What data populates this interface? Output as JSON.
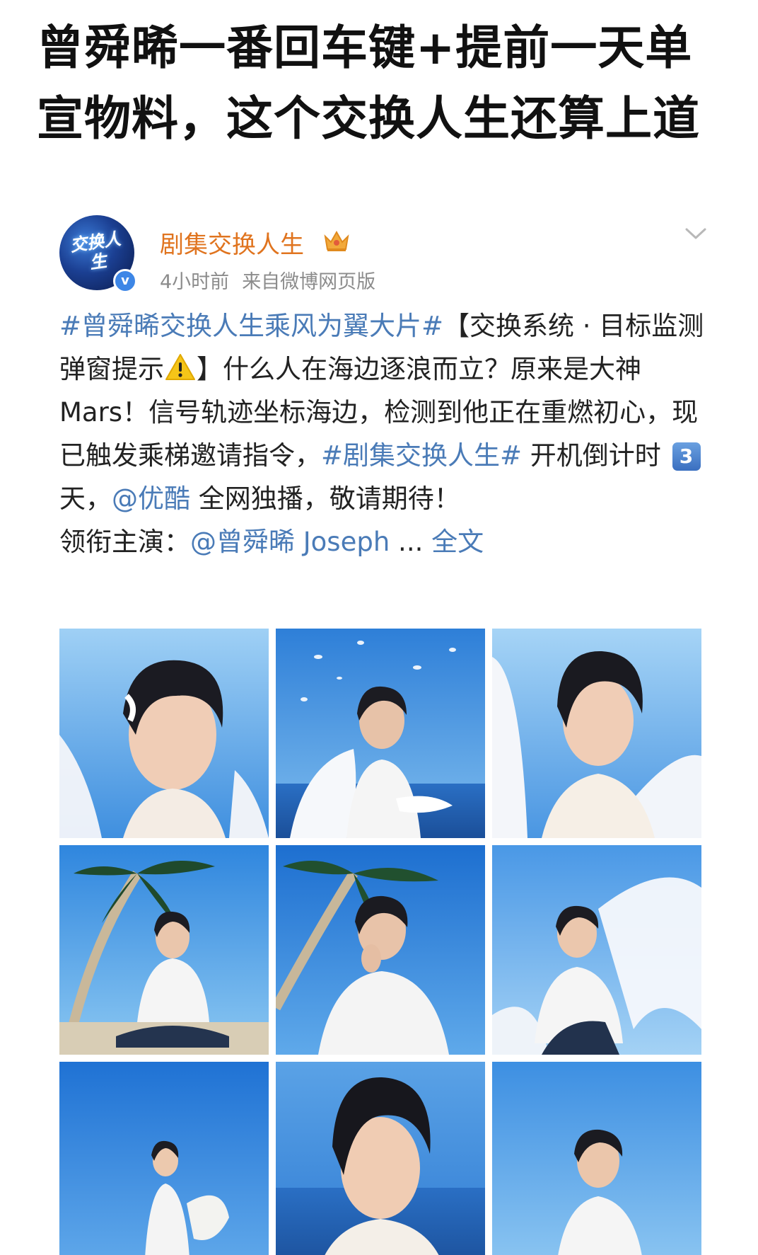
{
  "headline": {
    "line1": "曾舜晞一番回车键+提前一天单",
    "line2": "宣物料，这个交换人生还算上道"
  },
  "post": {
    "avatar_text": "交换人生",
    "verified_mark": "v",
    "account_name": "剧集交换人生",
    "time_ago": "4小时前",
    "source": "来自微博网页版",
    "text": {
      "tag1": "#曾舜晞交换人生乘风为翼大片#",
      "seg1": "【交换系统 · 目标监测弹窗提示",
      "seg2": "】什么人在海边逐浪而立？原来是大神Mars！信号轨迹坐标海边，检测到他正在重燃初心，现已触发乘梯邀请指令，",
      "tag2": "#剧集交换人生#",
      "seg3": " 开机倒计时 ",
      "countdown": "3",
      "seg4": "天，",
      "mention1": "@优酷",
      "seg5": " 全网独播，敬请期待！",
      "seg6": "领衔主演：",
      "mention2": "@曾舜晞 Joseph",
      "ellipsis": " ... ",
      "full_text_link": "全文"
    }
  },
  "colors": {
    "link": "#4a7bb7",
    "account_name": "#e0741f",
    "meta": "#8c8c8c",
    "sky_light": "#8fc4f0",
    "sky_deep": "#1e6fd0"
  },
  "photos": [
    {
      "scene": "portrait-wing"
    },
    {
      "scene": "doves-sea"
    },
    {
      "scene": "portrait-wing-right"
    },
    {
      "scene": "palm-sitting"
    },
    {
      "scene": "palm-hand-mouth"
    },
    {
      "scene": "sitting-fabric"
    },
    {
      "scene": "standing-board"
    },
    {
      "scene": "close-portrait"
    },
    {
      "scene": "side-portrait"
    }
  ]
}
